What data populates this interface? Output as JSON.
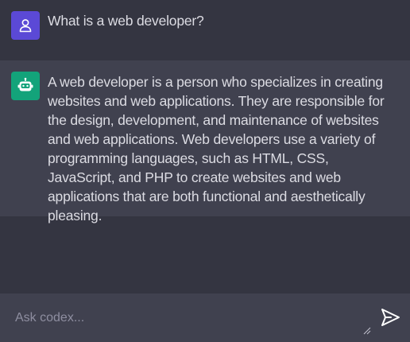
{
  "conversation": {
    "user_message": {
      "avatar_icon": "user-icon",
      "text": "What is a web developer?"
    },
    "bot_message": {
      "avatar_icon": "robot-icon",
      "text": "A web developer is a person who specializes in creating websites and web applications. They are responsible for the design, development, and maintenance of websites and web applications. Web developers use a variety of programming languages, such as HTML, CSS, JavaScript, and PHP to create websites and web applications that are both functional and aesthetically pleasing."
    }
  },
  "composer": {
    "placeholder": "Ask codex...",
    "value": "",
    "send_icon": "send-icon"
  },
  "colors": {
    "background": "#343541",
    "panel": "#40414f",
    "user_avatar": "#5b49d6",
    "bot_avatar": "#13a37a",
    "text": "#dcdce3"
  }
}
